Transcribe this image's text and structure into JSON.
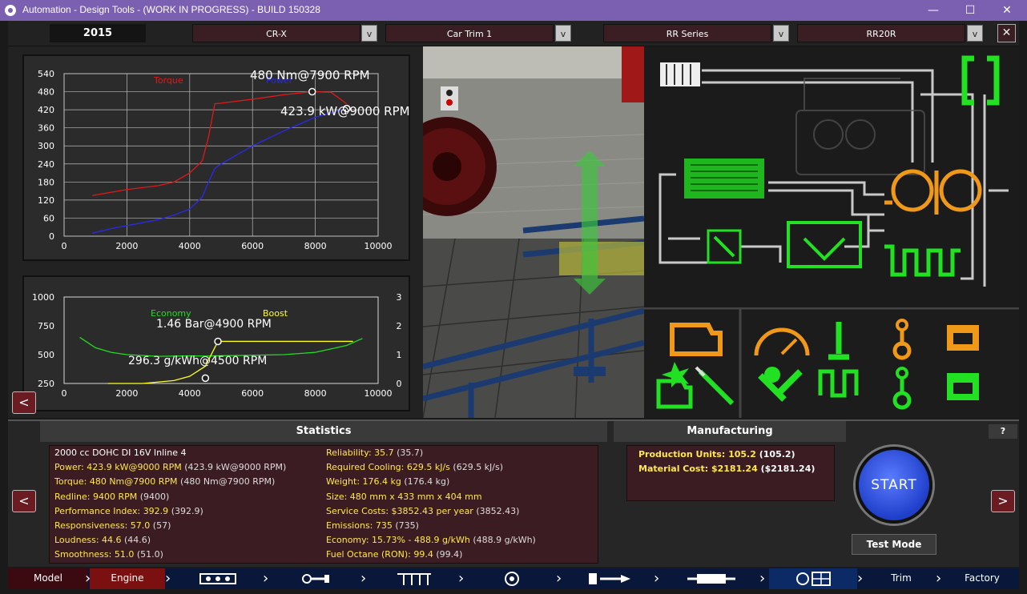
{
  "window": {
    "title": "Automation - Design Tools - (WORK IN PROGRESS) - BUILD 150328",
    "minimize": "—",
    "maximize": "☐",
    "close": "✕"
  },
  "topbar": {
    "year": "2015",
    "model": "CR-X",
    "trim": "Car Trim 1",
    "engine_family": "RR Series",
    "engine_variant": "RR20R",
    "dropdown_glyph": "v",
    "close_glyph": "✕"
  },
  "chart_data": [
    {
      "type": "line",
      "xlim": [
        0,
        10000
      ],
      "ylim": [
        0,
        540
      ],
      "xticks": [
        "0",
        "2000",
        "4000",
        "6000",
        "8000",
        "10000"
      ],
      "yticks": [
        "0",
        "60",
        "120",
        "180",
        "240",
        "300",
        "360",
        "420",
        "480",
        "540"
      ],
      "grid": true,
      "annotations": [
        "480 Nm@7900 RPM",
        "423.9 kW@9000 RPM"
      ],
      "series": [
        {
          "name": "Torque",
          "color": "#e01818",
          "x": [
            900,
            2000,
            3000,
            3500,
            4000,
            4400,
            4600,
            4800,
            5000,
            6000,
            7000,
            7900,
            8500,
            9000
          ],
          "y": [
            135,
            155,
            168,
            180,
            210,
            250,
            330,
            440,
            442,
            455,
            470,
            480,
            478,
            440
          ]
        },
        {
          "name": "Power",
          "color": "#2a2af0",
          "x": [
            900,
            1500,
            2000,
            3000,
            3500,
            4000,
            4400,
            4600,
            4800,
            5000,
            6000,
            7000,
            8000,
            9000
          ],
          "y": [
            10,
            25,
            35,
            55,
            70,
            90,
            130,
            180,
            225,
            240,
            300,
            350,
            395,
            423.9
          ]
        }
      ]
    },
    {
      "type": "line",
      "xlim": [
        0,
        10000
      ],
      "ylim": [
        250,
        1000
      ],
      "y2lim": [
        0,
        3
      ],
      "xticks": [
        "0",
        "2000",
        "4000",
        "6000",
        "8000",
        "10000"
      ],
      "yticks": [
        "250",
        "500",
        "750",
        "1000"
      ],
      "y2ticks": [
        "0",
        "1",
        "2",
        "3"
      ],
      "grid": false,
      "annotations": [
        "1.46 Bar@4900 RPM",
        "296.3 g/kWh@4500 RPM"
      ],
      "series": [
        {
          "name": "Economy",
          "color": "#22dd22",
          "axis": "left",
          "x": [
            500,
            1000,
            1500,
            2000,
            3000,
            4000,
            4500,
            5000,
            6000,
            7000,
            8000,
            9000,
            9500
          ],
          "y": [
            650,
            560,
            520,
            500,
            485,
            489,
            488,
            490,
            495,
            500,
            520,
            580,
            640
          ]
        },
        {
          "name": "Boost",
          "color": "#ffff22",
          "axis": "right",
          "x": [
            1400,
            2500,
            3500,
            4000,
            4500,
            4900,
            5500,
            7000,
            8500,
            9200
          ],
          "y": [
            0,
            0,
            0.1,
            0.25,
            0.6,
            1.46,
            1.46,
            1.46,
            1.46,
            1.46
          ]
        }
      ]
    }
  ],
  "sections": {
    "statistics": "Statistics",
    "manufacturing": "Manufacturing",
    "help": "?"
  },
  "stats_left": [
    {
      "label": "2000 cc DOHC DI 16V Inline 4",
      "paren": ""
    },
    {
      "label": "Power: 423.9 kW@9000 RPM",
      "paren": "(423.9 kW@9000 RPM)"
    },
    {
      "label": "Torque: 480 Nm@7900 RPM",
      "paren": "(480 Nm@7900 RPM)"
    },
    {
      "label": "Redline: 9400 RPM",
      "paren": "(9400)"
    },
    {
      "label": "Performance Index: 392.9",
      "paren": "(392.9)"
    },
    {
      "label": "Responsiveness: 57.0",
      "paren": "(57)"
    },
    {
      "label": "Loudness: 44.6",
      "paren": "(44.6)"
    },
    {
      "label": "Smoothness: 51.0",
      "paren": "(51.0)"
    }
  ],
  "stats_right": [
    {
      "label": "Reliability: 35.7",
      "paren": "(35.7)"
    },
    {
      "label": "Required Cooling: 629.5 kJ/s",
      "paren": "(629.5 kJ/s)"
    },
    {
      "label": "Weight: 176.4 kg",
      "paren": "(176.4 kg)"
    },
    {
      "label": "Size: 480 mm x 433 mm x 404 mm",
      "paren": ""
    },
    {
      "label": "Service Costs: $3852.43 per year",
      "paren": "(3852.43)"
    },
    {
      "label": "Emissions: 735",
      "paren": "(735)"
    },
    {
      "label": "Economy: 15.73% - 488.9 g/kWh",
      "paren": "(488.9 g/kWh)"
    },
    {
      "label": "Fuel Octane (RON): 99.4",
      "paren": "(99.4)"
    }
  ],
  "manufacturing": [
    {
      "label": "Production Units: 105.2",
      "paren": "(105.2)"
    },
    {
      "label": "Material Cost: $2181.24",
      "paren": "($2181.24)"
    }
  ],
  "buttons": {
    "start": "START",
    "test_mode": "Test Mode",
    "prev": "<",
    "next": ">"
  },
  "nav": {
    "model": "Model",
    "engine": "Engine",
    "trim": "Trim",
    "factory": "Factory",
    "chevron": "›"
  }
}
